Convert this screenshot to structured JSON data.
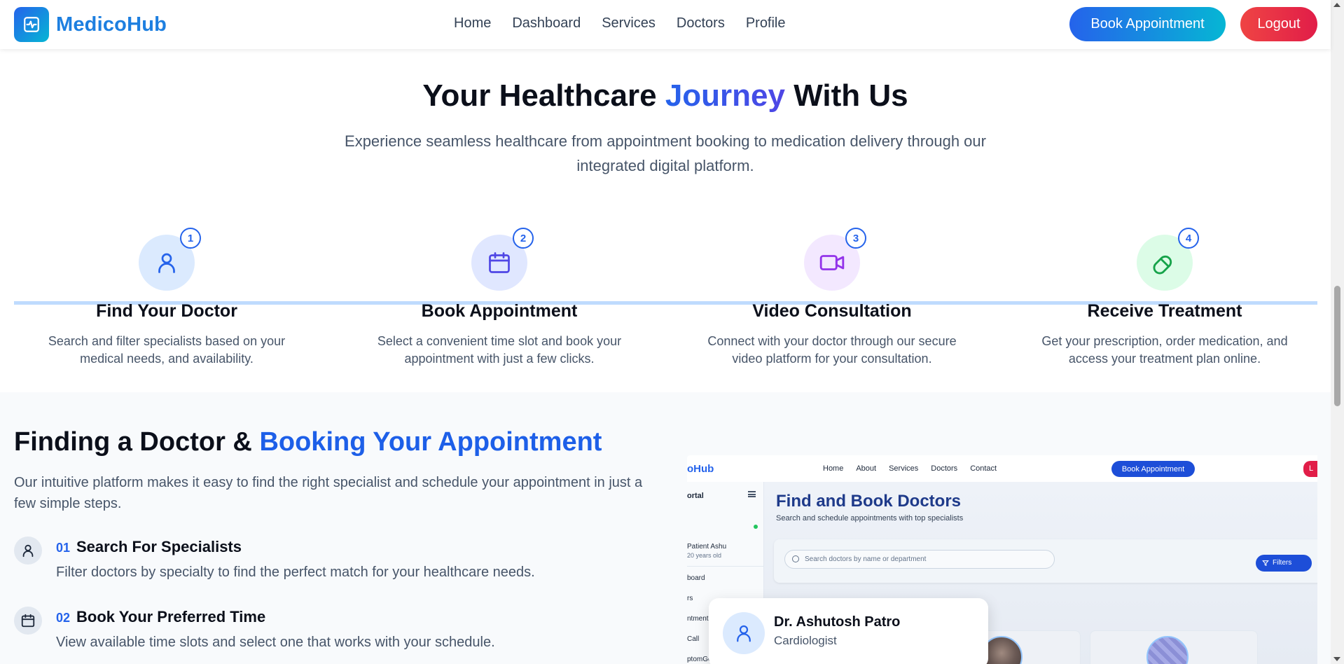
{
  "brand": {
    "name": "MedicoHub",
    "logo_icon": "activity-icon"
  },
  "nav": {
    "links": [
      "Home",
      "Dashboard",
      "Services",
      "Doctors",
      "Profile"
    ],
    "book_label": "Book Appointment",
    "logout_label": "Logout"
  },
  "hero": {
    "title_prefix": "Your Healthcare ",
    "title_accent": "Journey",
    "title_suffix": " With Us",
    "subtitle": "Experience seamless healthcare from appointment booking to medication delivery through our integrated digital platform."
  },
  "steps": [
    {
      "number": "1",
      "icon": "user-icon",
      "title": "Find Your Doctor",
      "desc": "Search and filter specialists based on your medical needs, and availability.",
      "bg": "#dbeafe",
      "color": "#2563eb"
    },
    {
      "number": "2",
      "icon": "calendar-icon",
      "title": "Book Appointment",
      "desc": "Select a convenient time slot and book your appointment with just a few clicks.",
      "bg": "#e0e7ff",
      "color": "#4f46e5"
    },
    {
      "number": "3",
      "icon": "video-icon",
      "title": "Video Consultation",
      "desc": "Connect with your doctor through our secure video platform for your consultation.",
      "bg": "#f3e8ff",
      "color": "#9333ea"
    },
    {
      "number": "4",
      "icon": "pill-icon",
      "title": "Receive Treatment",
      "desc": "Get your prescription, order medication, and access your treatment plan online.",
      "bg": "#dcfce7",
      "color": "#16a34a"
    }
  ],
  "section": {
    "title_prefix": "Finding a Doctor & ",
    "title_accent": "Booking Your Appointment",
    "desc": "Our intuitive platform makes it easy to find the right specialist and schedule your appointment in just a few simple steps.",
    "features": [
      {
        "num": "01",
        "icon": "user-icon",
        "title": "Search For Specialists",
        "desc": "Filter doctors by specialty to find the perfect match for your healthcare needs."
      },
      {
        "num": "02",
        "icon": "calendar-icon",
        "title": "Book Your Preferred Time",
        "desc": "View available time slots and select one that works with your schedule."
      }
    ]
  },
  "preview": {
    "brand": "oHub",
    "links": [
      "Home",
      "About",
      "Services",
      "Doctors",
      "Contact"
    ],
    "book_label": "Book Appointment",
    "logout_label": "L",
    "sidebar_title": "ortal",
    "patient_name": "Patient Ashu",
    "patient_age": "20 years old",
    "sidebar_items": [
      "board",
      "rs",
      "ntments",
      "Call",
      "ptomGe"
    ],
    "title": "Find and Book Doctors",
    "subtitle": "Search and schedule appointments with top specialists",
    "search_placeholder": "Search doctors by name or department",
    "filters_label": "Filters"
  },
  "doctor_card": {
    "name": "Dr. Ashutosh Patro",
    "specialty": "Cardiologist"
  },
  "colors": {
    "primary": "#2563eb",
    "accent_cyan": "#06b6d4",
    "logout_red": "#e11d48"
  }
}
